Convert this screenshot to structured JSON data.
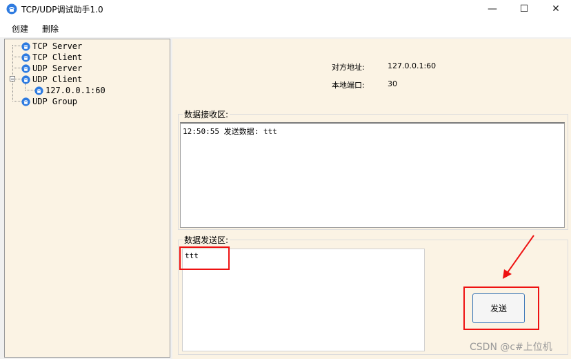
{
  "window": {
    "title": "TCP/UDP调试助手1.0",
    "minimize": "—",
    "maximize": "☐",
    "close": "✕"
  },
  "menu": {
    "items": [
      "创建",
      "删除"
    ]
  },
  "tree": {
    "nodes": [
      {
        "label": "TCP Server"
      },
      {
        "label": "TCP Client"
      },
      {
        "label": "UDP Server"
      },
      {
        "label": "UDP Client",
        "expanded": true
      },
      {
        "label": "127.0.0.1:60"
      },
      {
        "label": "UDP Group"
      }
    ]
  },
  "info": {
    "peer_label": "对方地址:",
    "peer_value": "127.0.0.1:60",
    "local_label": "本地端口:",
    "local_value": "30"
  },
  "receive": {
    "title": "数据接收区:",
    "content": "12:50:55 发送数据: ttt"
  },
  "send": {
    "title": "数据发送区:",
    "content": "ttt",
    "button_label": "发送"
  },
  "watermark": "CSDN @c#上位机",
  "colors": {
    "panel": "#fbf3e4",
    "annotation": "#ee1111",
    "node_icon": "#2e7be0"
  }
}
